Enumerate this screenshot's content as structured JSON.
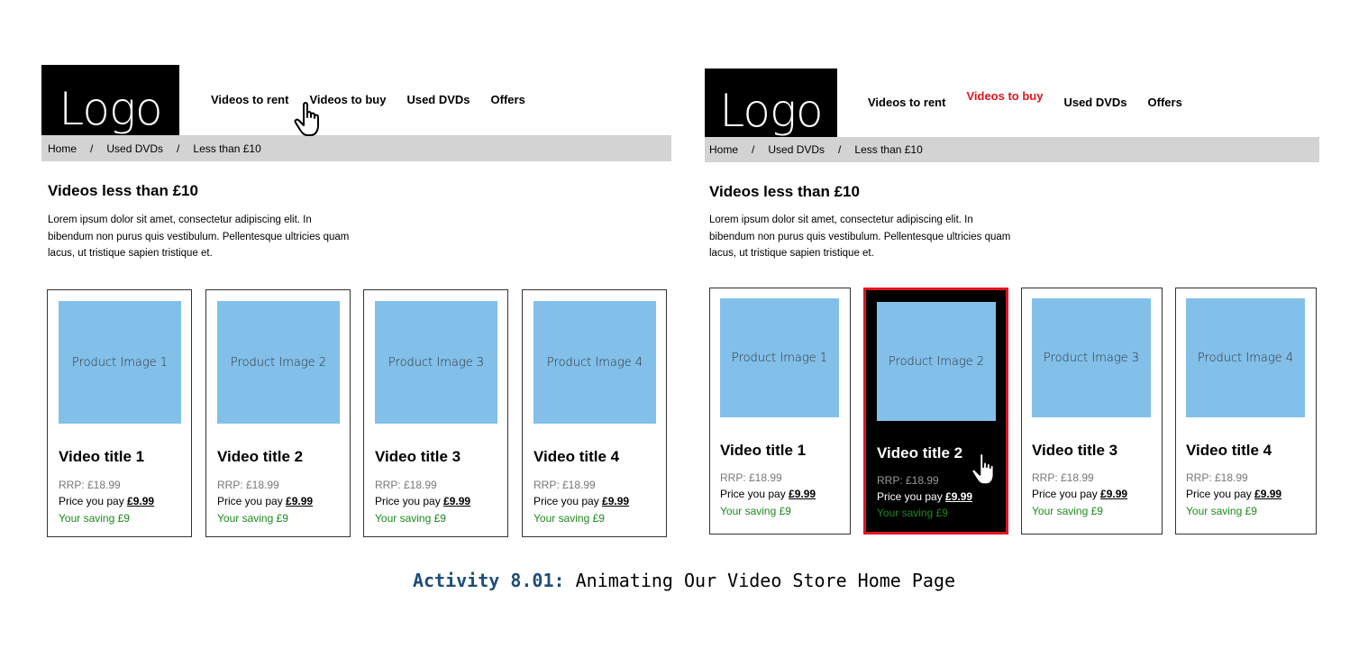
{
  "logo": "Logo",
  "nav": [
    "Videos to rent",
    "Videos to buy",
    "Used DVDs",
    "Offers"
  ],
  "breadcrumb": [
    "Home",
    "Used DVDs",
    "Less than £10"
  ],
  "breadcrumb_separator": "/",
  "page": {
    "title": "Videos less than £10",
    "description": "Lorem ipsum dolor sit amet, consectetur adipiscing elit. In bibendum non purus quis vestibulum. Pellentesque ultricies quam lacus, ut tristique sapien tristique et."
  },
  "products": [
    {
      "image": "Product Image 1",
      "title": "Video title 1",
      "rrp": "RRP: £18.99",
      "pay_label": "Price you pay",
      "pay_price": "£9.99",
      "saving": "Your saving £9"
    },
    {
      "image": "Product Image 2",
      "title": "Video title 2",
      "rrp": "RRP: £18.99",
      "pay_label": "Price you pay",
      "pay_price": "£9.99",
      "saving": "Your saving £9"
    },
    {
      "image": "Product Image 3",
      "title": "Video title 3",
      "rrp": "RRP: £18.99",
      "pay_label": "Price you pay",
      "pay_price": "£9.99",
      "saving": "Your saving £9"
    },
    {
      "image": "Product Image 4",
      "title": "Video title 4",
      "rrp": "RRP: £18.99",
      "pay_label": "Price you pay",
      "pay_price": "£9.99",
      "saving": "Your saving £9"
    }
  ],
  "caption": {
    "label": "Activity 8.01:",
    "text": "Animating Our Video Store Home Page"
  },
  "colors": {
    "accent": "#e3141e",
    "image_placeholder": "#82c0ea",
    "saving": "#1d8a1d",
    "caption_label": "#1f4e79",
    "breadcrumb_bg": "#d3d3d3"
  },
  "icons": {
    "cursor": "hand-pointer-icon"
  }
}
